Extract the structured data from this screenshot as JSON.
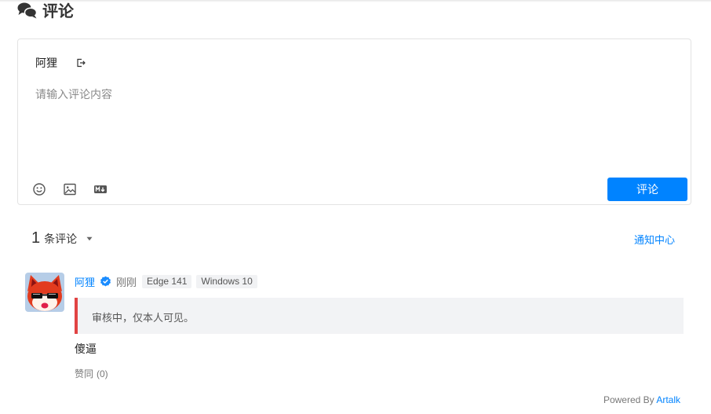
{
  "section": {
    "title": "评论",
    "icon": "chat-bubbles-icon"
  },
  "editor": {
    "user_name": "阿狸",
    "logout_icon": "logout-icon",
    "placeholder": "请输入评论内容",
    "tools": [
      "emoji-icon",
      "image-icon",
      "markdown-icon"
    ],
    "submit_label": "评论",
    "accent": "#0083ff"
  },
  "list": {
    "count": "1",
    "count_label": "条评论",
    "sort_icon": "caret-down-icon",
    "notify_label": "通知中心"
  },
  "comments": [
    {
      "nick": "阿狸",
      "verified_icon": "verified-badge-icon",
      "time": "刚刚",
      "badges": [
        "Edge 141",
        "Windows 10"
      ],
      "pending_notice": "审核中，仅本人可见。",
      "content": "傻逼",
      "vote_label": "赞同",
      "vote_count": "(0)",
      "pending_color": "#e14343"
    }
  ],
  "footer": {
    "prefix": "Powered By",
    "brand": "Artalk"
  }
}
